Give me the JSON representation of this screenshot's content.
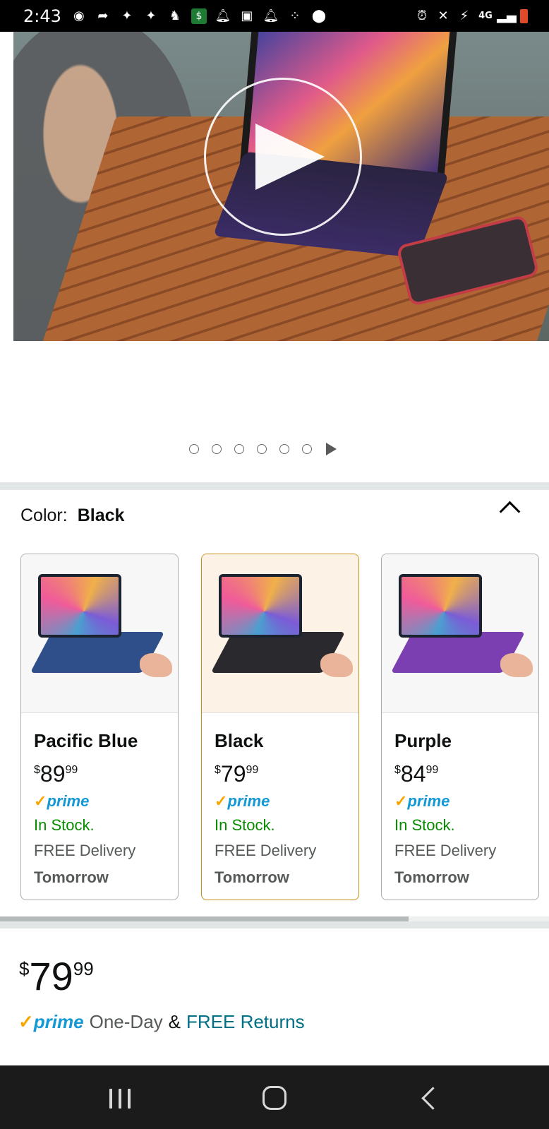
{
  "status_bar": {
    "time": "2:43",
    "network": "4G",
    "icons_left": [
      "messenger-icon",
      "arrow-icon",
      "twitter-icon",
      "twitter-icon",
      "robinhood-icon",
      "cash-app-icon",
      "bell-icon",
      "gallery-icon",
      "bell-icon",
      "dots-icon",
      "location-icon"
    ],
    "icons_right": [
      "alarm-icon",
      "mute-icon",
      "data-icon",
      "signal-icon",
      "battery-icon"
    ]
  },
  "media": {
    "type": "video",
    "dot_count": 6,
    "play_label": "Play video"
  },
  "color": {
    "label": "Color:",
    "selected": "Black"
  },
  "variants": [
    {
      "name": "Pacific Blue",
      "currency": "$",
      "whole": "89",
      "fraction": "99",
      "prime": "prime",
      "stock": "In Stock.",
      "delivery_line1": "FREE Delivery",
      "delivery_line2": "Tomorrow",
      "accent": "#2f4f8a",
      "selected": false
    },
    {
      "name": "Black",
      "currency": "$",
      "whole": "79",
      "fraction": "99",
      "prime": "prime",
      "stock": "In Stock.",
      "delivery_line1": "FREE Delivery",
      "delivery_line2": "Tomorrow",
      "accent": "#2a2a2e",
      "selected": true
    },
    {
      "name": "Purple",
      "currency": "$",
      "whole": "84",
      "fraction": "99",
      "prime": "prime",
      "stock": "In Stock.",
      "delivery_line1": "FREE Delivery",
      "delivery_line2": "Tomorrow",
      "accent": "#7b3fb2",
      "selected": false
    }
  ],
  "price": {
    "currency": "$",
    "whole": "79",
    "fraction": "99"
  },
  "shipping": {
    "prime": "prime",
    "speed": "One-Day",
    "amp": "&",
    "returns": "FREE Returns"
  },
  "colors": {
    "prime_blue": "#1399d6",
    "prime_check": "#f7a600",
    "in_stock": "#078c00",
    "link": "#007185",
    "selected_border": "#c7901a"
  }
}
